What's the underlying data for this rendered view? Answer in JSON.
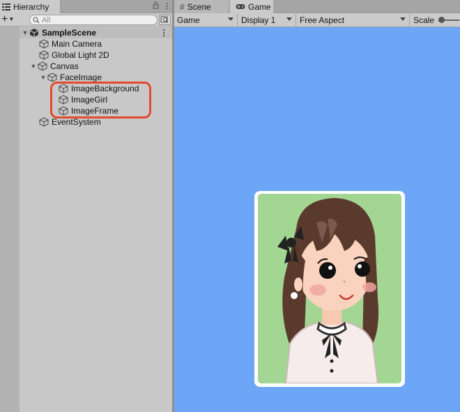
{
  "hierarchy": {
    "tab_label": "Hierarchy",
    "search_placeholder": "All",
    "scene_name": "SampleScene",
    "objects": [
      {
        "label": "Main Camera"
      },
      {
        "label": "Global Light 2D"
      },
      {
        "label": "Canvas"
      },
      {
        "label": "FaceImage"
      },
      {
        "label": "ImageBackground"
      },
      {
        "label": "ImageGirl"
      },
      {
        "label": "ImageFrame"
      },
      {
        "label": "EventSystem"
      }
    ]
  },
  "game_view": {
    "tabs": [
      {
        "label": "Scene"
      },
      {
        "label": "Game"
      }
    ],
    "toolbar": {
      "mode": "Game",
      "display": "Display 1",
      "aspect": "Free Aspect",
      "scale_label": "Scale"
    },
    "background_color": "#6ea6f7"
  },
  "colors": {
    "highlight": "#e24a2b",
    "portrait_bg": "#a2d692",
    "frame": "#ffffff"
  }
}
